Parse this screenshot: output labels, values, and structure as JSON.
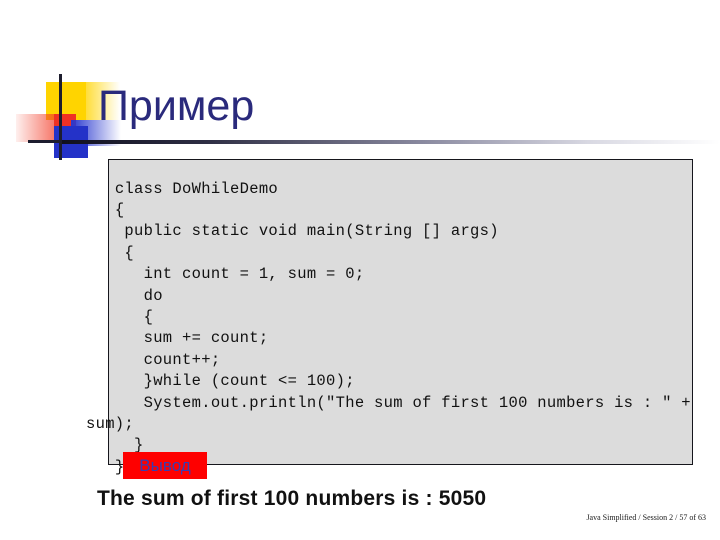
{
  "slide": {
    "title": "Пример",
    "logo": {
      "yellow": "#ffd400",
      "red": "#ef3124",
      "blue": "#2432c8",
      "cross": "#1d1d2e"
    },
    "title_color": "#2a2a7c"
  },
  "code": {
    "language": "java",
    "text": "   class DoWhileDemo\n   {\n    public static void main(String [] args)\n    {\n      int count = 1, sum = 0;\n      do\n      {\n      sum += count;\n      count++;\n      }while (count <= 100);\n      System.out.println(\"The sum of first 100 numbers is : \" + sum);\n     }\n   }"
  },
  "output": {
    "badge_label": "Вывод",
    "badge_bg": "#fe0000",
    "badge_text_color": "#3b3bb0",
    "result_text": "The sum of first 100 numbers is : 5050"
  },
  "footer": {
    "text": "Java Simplified / Session 2 / 57 of 63"
  }
}
